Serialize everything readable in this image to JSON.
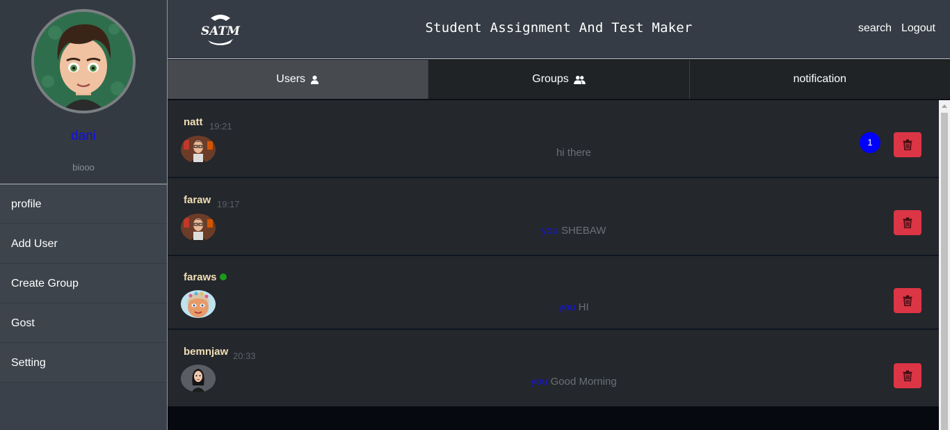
{
  "app": {
    "title": "Student Assignment And Test Maker",
    "logo_text": "SATM"
  },
  "header": {
    "search_label": "search",
    "logout_label": "Logout"
  },
  "profile": {
    "name": "dani",
    "subtitle": "biooo"
  },
  "sidebar": {
    "items": [
      {
        "label": "profile"
      },
      {
        "label": "Add User"
      },
      {
        "label": "Create Group"
      },
      {
        "label": "Gost"
      },
      {
        "label": "Setting"
      }
    ]
  },
  "tabs": [
    {
      "label": "Users",
      "icon": "user-icon",
      "active": true
    },
    {
      "label": "Groups",
      "icon": "users-icon",
      "active": false
    },
    {
      "label": "notification",
      "icon": "",
      "active": false
    }
  ],
  "conversations": [
    {
      "name": "natt",
      "time": "19:21",
      "you_prefix": "",
      "message": "hi there",
      "unread": "1",
      "online": false
    },
    {
      "name": "faraw",
      "time": "19:17",
      "you_prefix": "you",
      "message": "SHEBAW",
      "unread": "",
      "online": false
    },
    {
      "name": "faraws",
      "time": "",
      "you_prefix": "you",
      "message": "HI",
      "unread": "",
      "online": true
    },
    {
      "name": "bemnjaw",
      "time": "20:33",
      "you_prefix": "you",
      "message": "Good Morning",
      "unread": "",
      "online": false
    }
  ],
  "colors": {
    "accent_blue": "#0000ff",
    "delete_red": "#dc3545",
    "name_color": "#f1dfb6",
    "online_green": "#1d9a1d"
  }
}
